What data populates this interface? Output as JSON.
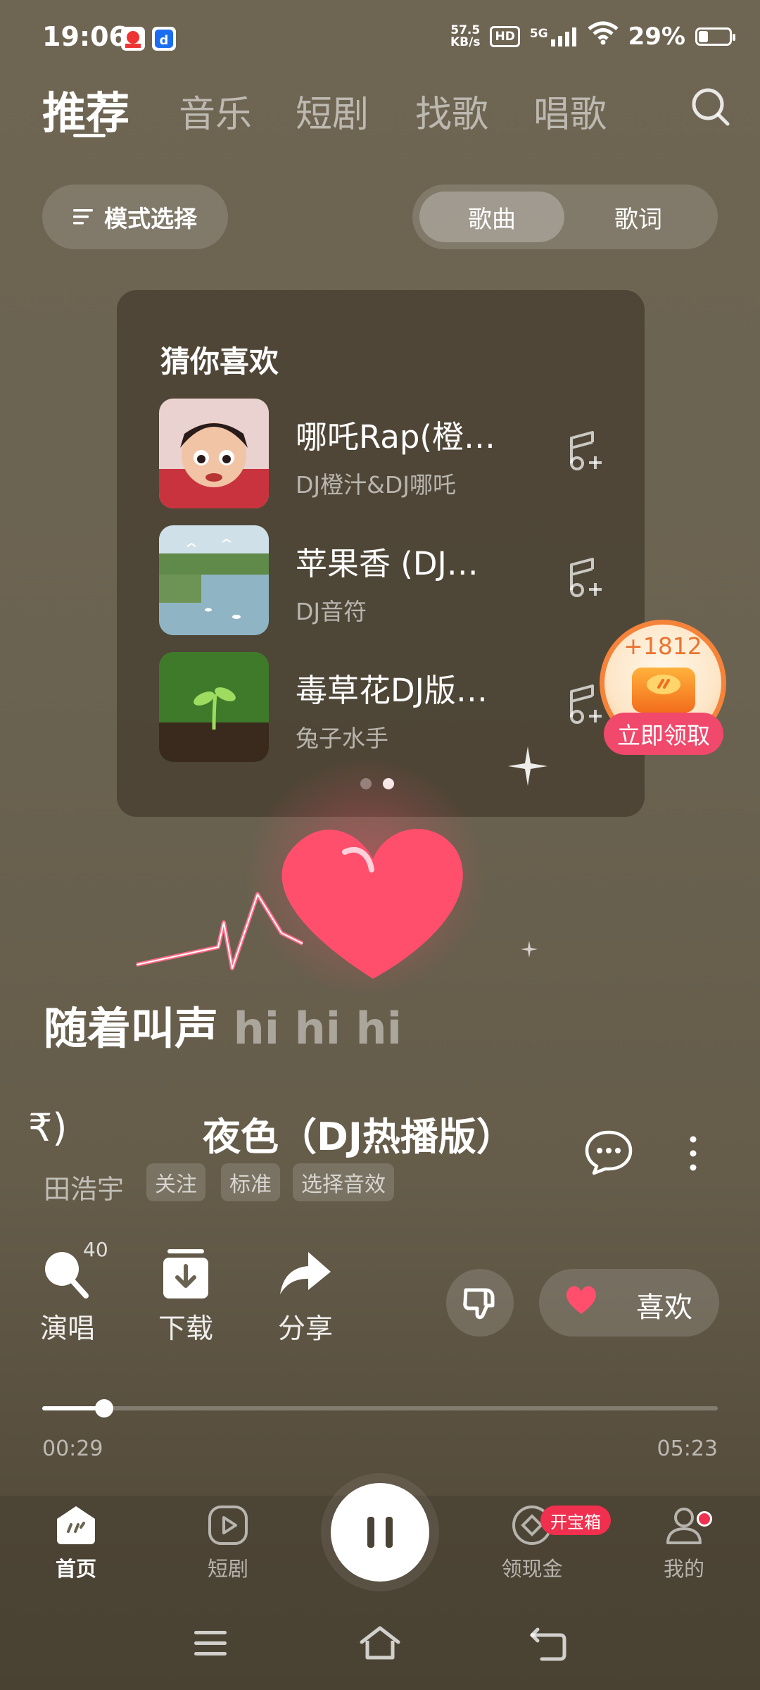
{
  "status_bar": {
    "time": "19:06",
    "net_speed_value": "57.5",
    "net_speed_unit": "KB/s",
    "hd": "HD",
    "network": "5G",
    "battery": "29%"
  },
  "top_tabs": [
    "推荐",
    "音乐",
    "短剧",
    "找歌",
    "唱歌"
  ],
  "mode_select": {
    "label": "模式选择"
  },
  "view_toggle": {
    "songs": "歌曲",
    "lyrics": "歌词"
  },
  "recommend": {
    "title": "猜你喜欢",
    "songs": [
      {
        "name": "哪吒Rap(橙…",
        "artist": "DJ橙汁&DJ哪吒"
      },
      {
        "name": "苹果香 (DJ…",
        "artist": "DJ音符"
      },
      {
        "name": "毒草花DJ版…",
        "artist": "兔子水手"
      }
    ]
  },
  "reward": {
    "amount": "+1812",
    "button": "立即领取"
  },
  "lyric": {
    "main": "随着叫声",
    "tail": "hi hi hi"
  },
  "now_playing": {
    "prev_fragment": "₹)",
    "title": "夜色（DJ热播版）",
    "artist": "田浩宇",
    "chips": [
      "关注",
      "标准",
      "选择音效"
    ]
  },
  "actions": {
    "sing": "演唱",
    "sing_count": "40",
    "download": "下载",
    "share": "分享",
    "like": "喜欢"
  },
  "progress": {
    "current": "00:29",
    "total": "05:23",
    "fraction": 0.092
  },
  "bottom_nav": {
    "home": "首页",
    "drama": "短剧",
    "cash": "领现金",
    "treasure_badge": "开宝箱",
    "mine": "我的"
  },
  "colors": {
    "accent_red": "#f0304e",
    "reward_orange": "#f5833a",
    "background": "#6b6351"
  }
}
